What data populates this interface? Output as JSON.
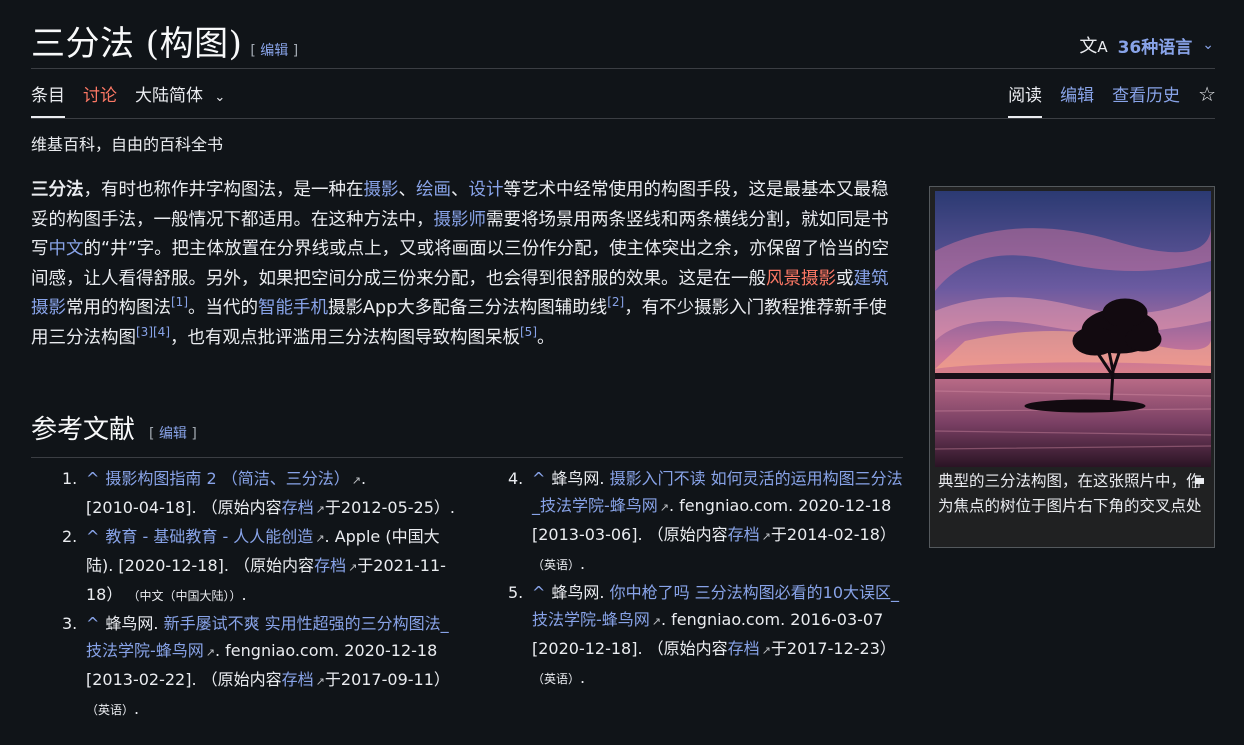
{
  "header": {
    "title": "三分法 (构图)",
    "edit_label": "编辑",
    "language_count": "36种语言"
  },
  "tabs_left": [
    "条目",
    "讨论",
    "大陆简体"
  ],
  "tabs_right": [
    "阅读",
    "编辑",
    "查看历史"
  ],
  "tagline": "维基百科，自由的百科全书",
  "lead": {
    "bold": "三分法",
    "t1": "，有时也称作井字构图法，是一种在",
    "l_photo": "摄影",
    "sep1": "、",
    "l_paint": "绘画",
    "sep2": "、",
    "l_design": "设计",
    "t2": "等艺术中经常使用的构图手段，这是最基本又最稳妥的构图手法，一般情况下都适用。在这种方法中，",
    "l_photographer": "摄影师",
    "t3": "需要将场景用两条竖线和两条横线分割，就如同是书写",
    "l_chinese": "中文",
    "t4": "的“井”字。把主体放置在分界线或点上，又或将画面以三份作分配，使主体突出之余，亦保留了恰当的空间感，让人看得舒服。另外，如果把空间分成三份来分配，也会得到很舒服的效果。这是在一般",
    "l_landscape": "风景摄影",
    "t5": "或",
    "l_arch": "建筑摄影",
    "t6": "常用的构图法",
    "c1": "[1]",
    "t7": "。当代的",
    "l_phone": "智能手机",
    "t8": "摄影App大多配备三分法构图辅助线",
    "c2": "[2]",
    "t9": "，有不少摄影入门教程推荐新手使用三分法构图",
    "c3": "[3]",
    "c4": "[4]",
    "t10": "，也有观点批评滥用三分法构图导致构图呆板",
    "c5": "[5]",
    "t11": "。"
  },
  "infobox": {
    "caption": "典型的三分法构图，在这张照片中，作为焦点的树位于图片右下角的交叉点处"
  },
  "references": {
    "heading": "参考文献",
    "edit_label": "编辑",
    "caret": "^",
    "archive_label": "存档",
    "items": [
      {
        "num": "1.",
        "link": "摄影构图指南 2 （简洁、三分法）",
        "rest_a": ".",
        "rest_b": "[2010-04-18]. （原始内容",
        "rest_c": "于2012-05-25）.",
        "lang": ""
      },
      {
        "num": "2.",
        "link": "教育 - 基础教育 - 人人能创造",
        "rest_a": ". Apple (中国大陆). [2020-12-18]. （原始内容",
        "rest_b": "",
        "rest_c": "于2021-11-18）",
        "lang": "（中文（中国大陆））",
        "tail": "."
      },
      {
        "num": "3.",
        "prefix": "蜂鸟网. ",
        "link": "新手屡试不爽 实用性超强的三分构图法_技法学院-蜂鸟网",
        "rest_a": ". fengniao.com. 2020-12-18 [2013-02-22]. （原始内容",
        "rest_c": "于2017-09-11）",
        "lang": "（英语）",
        "tail": "."
      },
      {
        "num": "4.",
        "prefix": "蜂鸟网. ",
        "link": "摄影入门不读 如何灵活的运用构图三分法_技法学院-蜂鸟网",
        "rest_a": ". fengniao.com. 2020-12-18 [2013-03-06]. （原始内容",
        "rest_c": "于2014-02-18）",
        "lang": "（英语）",
        "tail": "."
      },
      {
        "num": "5.",
        "prefix": "蜂鸟网. ",
        "link": "你中枪了吗 三分法构图必看的10大误区_技法学院-蜂鸟网",
        "rest_a": ". fengniao.com. 2016-03-07 [2020-12-18]. （原始内容",
        "rest_c": "于2017-12-23）",
        "lang": "（英语）",
        "tail": "."
      }
    ]
  },
  "colors": {
    "background": "#101418",
    "text": "#eaecf0",
    "link": "#88a3e8",
    "redlink": "#fd7865"
  }
}
